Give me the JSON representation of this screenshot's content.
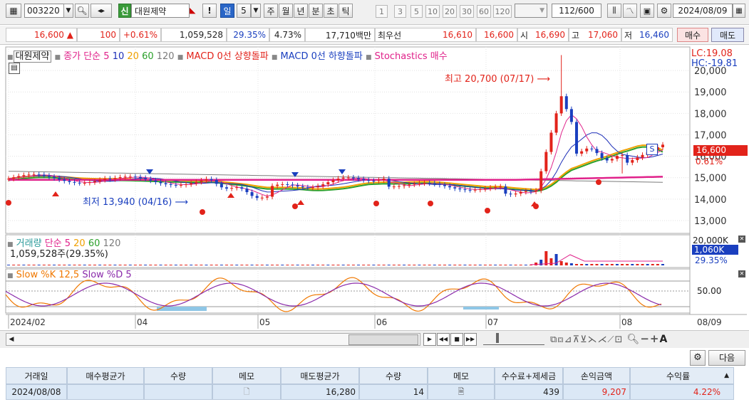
{
  "toolbar": {
    "code": "003220",
    "badge": "신",
    "name": "대원제약",
    "period_buttons": [
      "!",
      "일",
      "5",
      "주",
      "월",
      "년",
      "분",
      "초",
      "틱"
    ],
    "active_period": "일",
    "numbers": [
      "1",
      "3",
      "5",
      "10",
      "20",
      "30",
      "60",
      "120"
    ],
    "page_count": "112/600",
    "date": "2024/08/09"
  },
  "quote": {
    "price": "16,600",
    "change_arrow": "▲",
    "change": "100",
    "change_pct": "+0.61%",
    "volume": "1,059,528",
    "vol_ratio": "29.35%",
    "turnover": "4.73%",
    "trade_value": "17,710백만",
    "bid_label": "최우선",
    "bid": "16,610",
    "ask": "16,600",
    "open_label": "시",
    "open": "16,690",
    "high_label": "고",
    "high": "17,060",
    "low_label": "저",
    "low": "16,460",
    "buy_button": "매수",
    "sell_button": "매도"
  },
  "chart_legend": {
    "name": "대원제약",
    "ma_label": "종가 단순 5",
    "ma_periods": [
      "10",
      "20",
      "60",
      "120"
    ],
    "macd_up": "MACD 0선 상향돌파",
    "macd_down": "MACD 0선 하향돌파",
    "stoch": "Stochastics 매수",
    "lc": "LC:19.08",
    "hc": "HC:-19.81"
  },
  "annotations": {
    "max": "최고 20,700 (07/17)",
    "min": "최저 13,940 (04/16)",
    "price_tag": "16,600",
    "price_pct": "0.61%",
    "s_marker": "S"
  },
  "volume_panel": {
    "title": "거래량",
    "ma_label": "단순 5",
    "periods": [
      "20",
      "60",
      "120"
    ],
    "value": "1,059,528주(29.35%)",
    "axis_top": "20,000K",
    "tag_value": "1,060K",
    "tag_pct": "29.35%"
  },
  "stoch_panel": {
    "title_k": "Slow %K 12,5",
    "title_d": "Slow %D 5",
    "axis_label": "50.00"
  },
  "x_axis": {
    "labels": [
      "2024/02",
      "04",
      "05",
      "06",
      "07",
      "08"
    ],
    "right_label": "08/09"
  },
  "next_button": "다음",
  "grid": {
    "headers": [
      "거래일",
      "매수평균가",
      "수량",
      "메모",
      "매도평균가",
      "수량",
      "메모",
      "수수료+제세금",
      "손익금액",
      "수익률"
    ],
    "row": [
      "2024/08/08",
      "",
      "",
      "",
      "16,280",
      "14",
      "",
      "439",
      "9,207",
      "4.22%"
    ]
  },
  "colors": {
    "up": "#e2231a",
    "down": "#1a3fbf",
    "ma5": "#e0218a",
    "ma10": "#1d2fb8",
    "ma20": "#f0a000",
    "ma60": "#2aa02a",
    "ma120": "#7b7b7b"
  },
  "chart_data": {
    "type": "candlestick",
    "y_axis_ticks": [
      "20,000",
      "19,000",
      "18,000",
      "17,000",
      "16,000",
      "15,000",
      "14,000",
      "13,000"
    ],
    "ylim": [
      12600,
      20900
    ],
    "x_labels": [
      "2024/02",
      "04",
      "05",
      "06",
      "07",
      "08"
    ],
    "max_point": {
      "label": "최고",
      "value": 20700,
      "date": "07/17"
    },
    "min_point": {
      "label": "최저",
      "value": 13940,
      "date": "04/16"
    },
    "last_close": 16600
  }
}
